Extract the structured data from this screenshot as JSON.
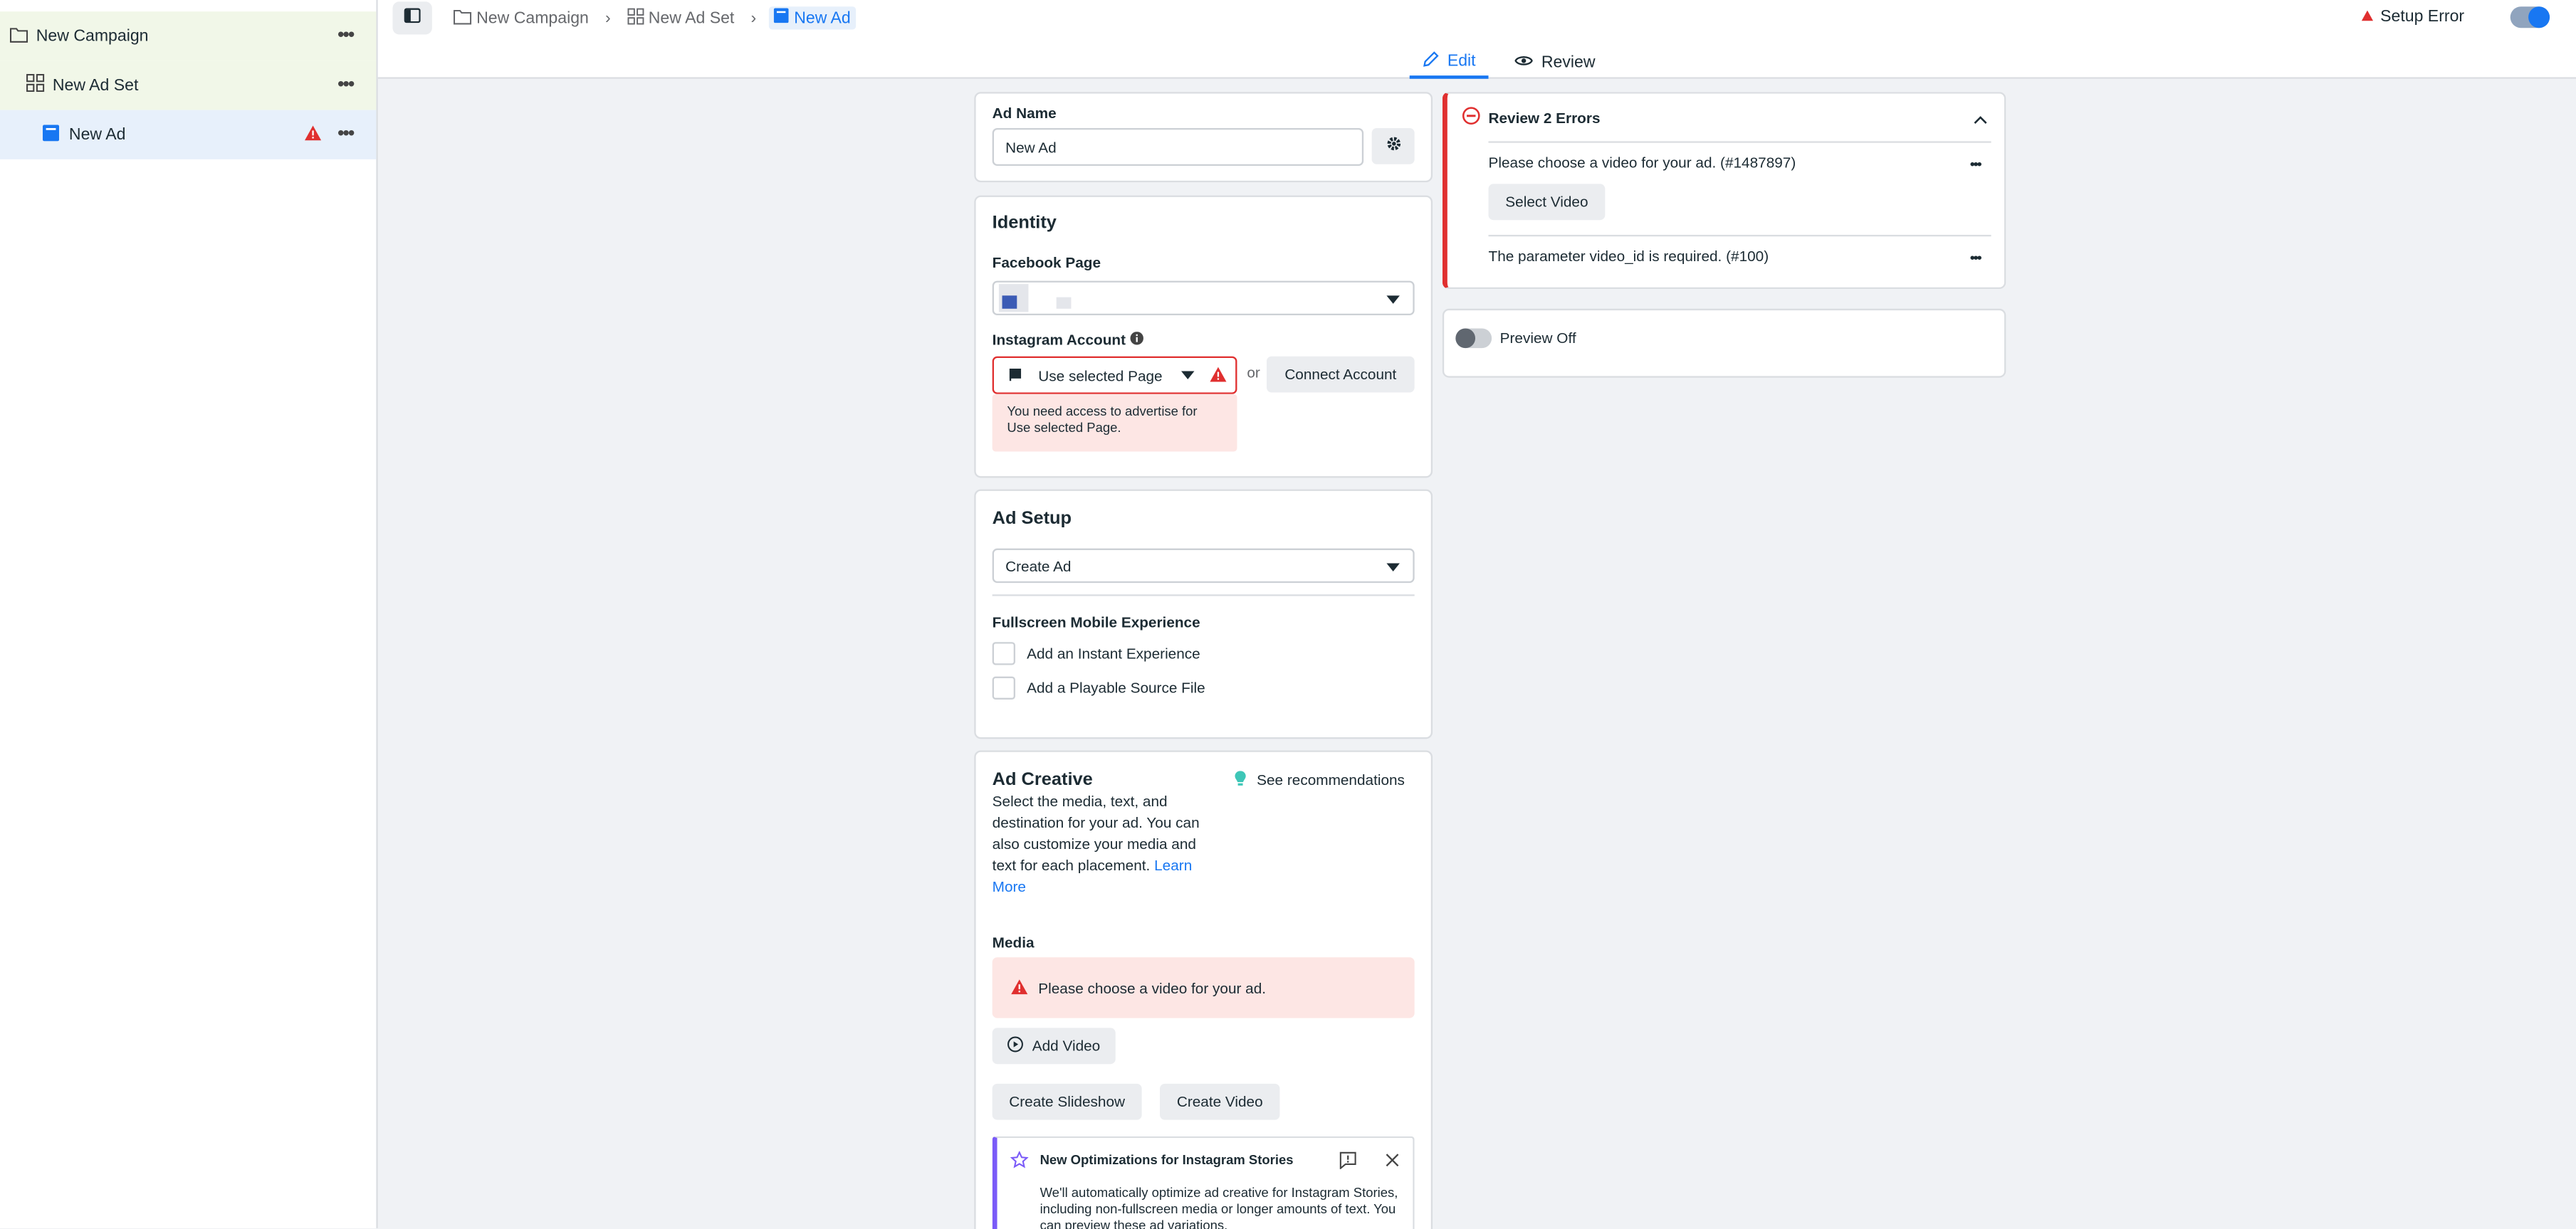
{
  "sidebar": {
    "items": [
      {
        "label": "New Campaign"
      },
      {
        "label": "New Ad Set"
      },
      {
        "label": "New Ad"
      }
    ]
  },
  "breadcrumb": {
    "items": [
      "New Campaign",
      "New Ad Set",
      "New Ad"
    ]
  },
  "status": {
    "setup_error": "Setup Error"
  },
  "tabs": [
    {
      "label": "Edit",
      "active": true
    },
    {
      "label": "Review",
      "active": false
    }
  ],
  "ad_name": {
    "label": "Ad Name",
    "value": "New Ad"
  },
  "identity": {
    "title": "Identity",
    "facebook_page_label": "Facebook Page",
    "instagram_label": "Instagram Account",
    "instagram_value": "Use selected Page",
    "or_text": "or",
    "connect_button": "Connect Account",
    "error_text": "You need access to advertise for Use selected Page."
  },
  "ad_setup": {
    "title": "Ad Setup",
    "select_value": "Create Ad",
    "fullscreen_label": "Fullscreen Mobile Experience",
    "options": [
      "Add an Instant Experience",
      "Add a Playable Source File"
    ]
  },
  "ad_creative": {
    "title": "Ad Creative",
    "recommendations": "See recommendations",
    "description": "Select the media, text, and destination for your ad. You can also customize your media and text for each placement.",
    "learn_more": "Learn More",
    "media_label": "Media",
    "media_error": "Please choose a video for your ad.",
    "add_video": "Add Video",
    "create_slideshow": "Create Slideshow",
    "create_video": "Create Video",
    "notice_title": "New Optimizations for Instagram Stories",
    "notice_body": "We'll automatically optimize ad creative for Instagram Stories, including non-fullscreen media or longer amounts of text. You can preview these ad variations."
  },
  "review": {
    "title": "Review 2 Errors",
    "errors": [
      {
        "text": "Please choose a video for your ad. (#1487897)",
        "action": "Select Video"
      },
      {
        "text": "The parameter video_id is required. (#100)"
      }
    ]
  },
  "preview": {
    "label": "Preview Off"
  },
  "colors": {
    "accent": "#1877f2",
    "error": "#e02f2f",
    "error_bg": "#fde6e4",
    "tree_green": "#f1f7e8",
    "tree_blue": "#e7f0fb",
    "notice_purple": "#7a5af8"
  },
  "icons": [
    "folder-icon",
    "adset-grid-icon",
    "ad-square-icon",
    "warning-icon",
    "more-icon",
    "sidebar-toggle-icon",
    "pencil-icon",
    "eye-icon",
    "gear-icon",
    "info-icon",
    "flag-icon",
    "bulb-icon",
    "play-icon",
    "star-icon",
    "feedback-icon",
    "close-icon",
    "error-circle-icon",
    "chevron-up-icon"
  ]
}
